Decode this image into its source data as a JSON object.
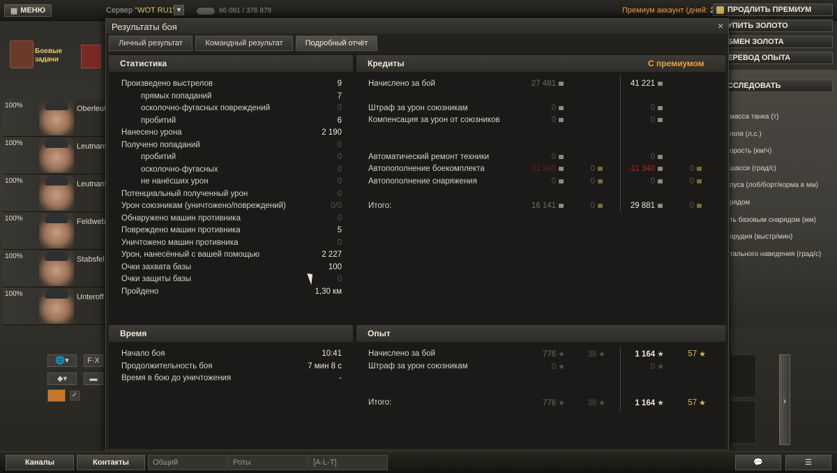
{
  "topbar": {
    "menu_label": "МЕНЮ",
    "server_prefix": "Сервер",
    "server_name": "\"WOT RU1\"",
    "online_counts": "86 081 / 376 879",
    "premium_label": "Премиум аккаунт (дней:",
    "premium_days": "2)",
    "buttons": [
      "ПРОДЛИТЬ ПРЕМИУМ",
      "УПИТЬ ЗОЛОТО",
      "БМЕН ЗОЛОТА",
      "ЕРЕВОД ОПЫТА",
      "ССЛЕДОВАТЬ"
    ]
  },
  "quests": {
    "label_line1": "Боевые",
    "label_line2": "задачи"
  },
  "crew": [
    {
      "pct": "100%",
      "rank": "Oberleut"
    },
    {
      "pct": "100%",
      "rank": "Leutnant"
    },
    {
      "pct": "100%",
      "rank": "Leutnant"
    },
    {
      "pct": "100%",
      "rank": "Feldweb"
    },
    {
      "pct": "100%",
      "rank": "Stabsfel"
    },
    {
      "pct": "100%",
      "rank": "Unteroff"
    }
  ],
  "left_tools": {
    "fx_label": "F·X"
  },
  "right_list": [
    "масса танка (т)",
    "геля (л.с.)",
    "орость (км/ч)",
    "шасси (град/с)",
    "пуса (лоб/борт/корма в мм)",
    "рядом",
    "ть базовым снарядом (мм)",
    "орудия (выстр/мин)",
    "тального наведения (град/с)"
  ],
  "dialog": {
    "title": "Результаты боя",
    "close": "×",
    "tabs": [
      "Личный результат",
      "Командный результат",
      "Подробный отчёт"
    ],
    "stats": {
      "header": "Статистика",
      "rows": [
        {
          "label": "Произведено выстрелов",
          "value": "9",
          "indent": false,
          "dim": false
        },
        {
          "label": "прямых попаданий",
          "value": "7",
          "indent": true,
          "dim": false
        },
        {
          "label": "осколочно-фугасных повреждений",
          "value": "0",
          "indent": true,
          "dim": true
        },
        {
          "label": "пробитий",
          "value": "6",
          "indent": true,
          "dim": false
        },
        {
          "label": "Нанесено урона",
          "value": "2 190",
          "indent": false,
          "dim": false
        },
        {
          "label": "Получено попаданий",
          "value": "0",
          "indent": false,
          "dim": true
        },
        {
          "label": "пробитий",
          "value": "0",
          "indent": true,
          "dim": true
        },
        {
          "label": "осколочно-фугасных",
          "value": "0",
          "indent": true,
          "dim": true
        },
        {
          "label": "не нанёсших урон",
          "value": "0",
          "indent": true,
          "dim": true
        },
        {
          "label": "Потенциальный полученный урон",
          "value": "0",
          "indent": false,
          "dim": true
        },
        {
          "label": "Урон союзникам (уничтожено/повреждений)",
          "value": "0/0",
          "indent": false,
          "dim": true
        },
        {
          "label": "Обнаружено машин противника",
          "value": "0",
          "indent": false,
          "dim": true
        },
        {
          "label": "Повреждено машин противника",
          "value": "5",
          "indent": false,
          "dim": false
        },
        {
          "label": "Уничтожено машин противника",
          "value": "0",
          "indent": false,
          "dim": true
        },
        {
          "label": "Урон, нанесённый с вашей помощью",
          "value": "2 227",
          "indent": false,
          "dim": false
        },
        {
          "label": "Очки захвата базы",
          "value": "100",
          "indent": false,
          "dim": false
        },
        {
          "label": "Очки защиты базы",
          "value": "0",
          "indent": false,
          "dim": true
        },
        {
          "label": "Пройдено",
          "value": "1,30 км",
          "indent": false,
          "dim": false
        }
      ]
    },
    "credits": {
      "header": "Кредиты",
      "premium_header": "С премиумом",
      "rows": [
        {
          "label": "Начислено за бой",
          "base": "27 481",
          "base_gold": "",
          "prem": "41 221",
          "prem_gold": "",
          "style": "normal"
        },
        {
          "label": "Штраф за урон союзникам",
          "base": "0",
          "base_gold": "",
          "prem": "0",
          "prem_gold": "",
          "style": "dim"
        },
        {
          "label": "Компенсация за урон от союзников",
          "base": "0",
          "base_gold": "",
          "prem": "0",
          "prem_gold": "",
          "style": "dim"
        },
        {
          "label": "Автоматический ремонт техники",
          "base": "0",
          "base_gold": "",
          "prem": "0",
          "prem_gold": "",
          "style": "dim"
        },
        {
          "label": "Автопополнение боекомплекта",
          "base": "-11 340",
          "base_gold": "0",
          "prem": "-11 340",
          "prem_gold": "0",
          "style": "red"
        },
        {
          "label": "Автопополнение снаряжения",
          "base": "0",
          "base_gold": "0",
          "prem": "0",
          "prem_gold": "0",
          "style": "dim"
        },
        {
          "label": "Итого:",
          "base": "16 141",
          "base_gold": "0",
          "prem": "29 881",
          "prem_gold": "0",
          "style": "total"
        }
      ]
    },
    "time": {
      "header": "Время",
      "rows": [
        {
          "label": "Начало боя",
          "value": "10:41"
        },
        {
          "label": "Продолжительность боя",
          "value": "7 мин 8 с"
        },
        {
          "label": "Время в бою до уничтожения",
          "value": "-"
        }
      ]
    },
    "experience": {
      "header": "Опыт",
      "rows": [
        {
          "label": "Начислено за бой",
          "base": "776",
          "base_free": "38",
          "prem": "1 164",
          "prem_free": "57"
        },
        {
          "label": "Штраф за урон союзникам",
          "base": "0",
          "base_free": "",
          "prem": "0",
          "prem_free": ""
        },
        {
          "label": "Итого:",
          "base": "776",
          "base_free": "38",
          "prem": "1 164",
          "prem_free": "57"
        }
      ]
    }
  },
  "bottombar": {
    "channels": "Каналы",
    "contacts": "Контакты",
    "chat_tabs": [
      "Общий",
      "Роты",
      "[A-L-T]"
    ]
  }
}
